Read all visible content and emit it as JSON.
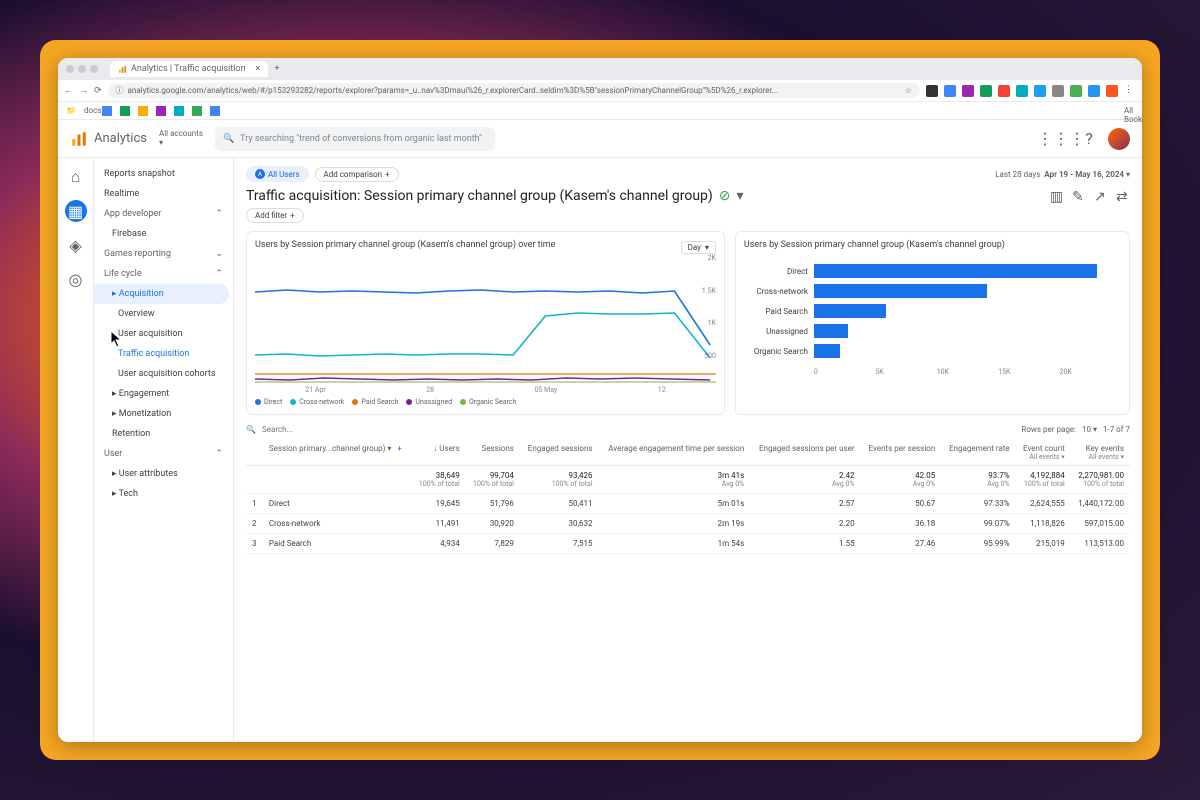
{
  "browser": {
    "tab_title": "Analytics | Traffic acquisition",
    "url": "analytics.google.com/analytics/web/#/p153293282/reports/explorer?params=_u..nav%3Dmaui%26_r.explorerCard..seldim%3D%5B\"sessionPrimaryChannelGroup\"%5D%26_r.explorer...",
    "bookmark_folder": "docs",
    "all_bookmarks": "All Bookmarks"
  },
  "header": {
    "product": "Analytics",
    "account_label": "All accounts",
    "search_placeholder": "Try searching \"trend of conversions from organic last month\""
  },
  "nav": {
    "snapshot": "Reports snapshot",
    "realtime": "Realtime",
    "app_dev": "App developer",
    "firebase": "Firebase",
    "games": "Games reporting",
    "lifecycle": "Life cycle",
    "acquisition": "Acquisition",
    "overview": "Overview",
    "user_acq": "User acquisition",
    "traffic_acq": "Traffic acquisition",
    "user_cohorts": "User acquisition cohorts",
    "engagement": "Engagement",
    "monetization": "Monetization",
    "retention": "Retention",
    "user": "User",
    "user_attr": "User attributes",
    "tech": "Tech"
  },
  "page": {
    "all_users": "All Users",
    "add_comparison": "Add comparison",
    "date_label": "Last 28 days",
    "date_range": "Apr 19 - May 16, 2024",
    "title": "Traffic acquisition: Session primary channel group (Kasem's channel group)",
    "add_filter": "Add filter"
  },
  "chart_data": [
    {
      "type": "line",
      "title": "Users by Session primary channel group (Kasem's channel group) over time",
      "interval": "Day",
      "x": [
        "21 Apr",
        "28",
        "05 May",
        "12"
      ],
      "ylim": [
        0,
        2000
      ],
      "yticks": [
        "2K",
        "1.5K",
        "1K",
        "500"
      ],
      "series": [
        {
          "name": "Direct",
          "color": "#1a73e8",
          "values": [
            1400,
            1450,
            1400,
            1420,
            1400,
            1380,
            1410,
            1430,
            1400,
            1420,
            1400,
            1410,
            1380,
            1420,
            600
          ]
        },
        {
          "name": "Cross-network",
          "color": "#12b5cb",
          "values": [
            450,
            460,
            440,
            450,
            460,
            450,
            455,
            460,
            450,
            1050,
            1100,
            1080,
            1070,
            1090,
            400
          ]
        },
        {
          "name": "Paid Search",
          "color": "#e8710a",
          "values": [
            150,
            160,
            150,
            155,
            150,
            160,
            155,
            150,
            155,
            160,
            150,
            155,
            160,
            150,
            120
          ]
        },
        {
          "name": "Unassigned",
          "color": "#7b1fa2",
          "values": [
            70,
            60,
            80,
            70,
            60,
            70,
            65,
            70,
            60,
            75,
            70,
            80,
            70,
            60,
            50
          ]
        },
        {
          "name": "Organic Search",
          "color": "#7cb342",
          "values": [
            40,
            45,
            40,
            42,
            40,
            41,
            43,
            40,
            42,
            40,
            41,
            40,
            42,
            40,
            35
          ]
        }
      ]
    },
    {
      "type": "bar",
      "title": "Users by Session primary channel group (Kasem's channel group)",
      "categories": [
        "Direct",
        "Cross-network",
        "Paid Search",
        "Unassigned",
        "Organic Search"
      ],
      "values": [
        19645,
        12000,
        4934,
        2200,
        1800
      ],
      "xlim": [
        0,
        20000
      ],
      "xticks": [
        "0",
        "5K",
        "10K",
        "15K",
        "20K"
      ]
    }
  ],
  "table": {
    "search_placeholder": "Search...",
    "rows_label": "Rows per page:",
    "rows_value": "10",
    "page_info": "1-7 of 7",
    "dim_header": "Session primary...channel group)",
    "cols": [
      {
        "h": "↓ Users"
      },
      {
        "h": "Sessions"
      },
      {
        "h": "Engaged sessions"
      },
      {
        "h": "Average engagement time per session"
      },
      {
        "h": "Engaged sessions per user"
      },
      {
        "h": "Events per session"
      },
      {
        "h": "Engagement rate"
      },
      {
        "h": "Event count",
        "sub": "All events ▾"
      },
      {
        "h": "Key events",
        "sub": "All events ▾"
      }
    ],
    "totals": {
      "users": {
        "v": "38,649",
        "s": "100% of total"
      },
      "sessions": {
        "v": "99,704",
        "s": "100% of total"
      },
      "engaged": {
        "v": "93,426",
        "s": "100% of total"
      },
      "avgeng": {
        "v": "3m 41s",
        "s": "Avg 0%"
      },
      "espu": {
        "v": "2.42",
        "s": "Avg 0%"
      },
      "eps": {
        "v": "42.05",
        "s": "Avg 0%"
      },
      "er": {
        "v": "93.7%",
        "s": "Avg 0%"
      },
      "ec": {
        "v": "4,192,884",
        "s": "100% of total"
      },
      "ke": {
        "v": "2,270,981.00",
        "s": "100% of total"
      }
    },
    "rows": [
      {
        "n": "1",
        "dim": "Direct",
        "v": [
          "19,645",
          "51,796",
          "50,411",
          "5m 01s",
          "2.57",
          "50.67",
          "97.33%",
          "2,624,555",
          "1,440,172.00"
        ]
      },
      {
        "n": "2",
        "dim": "Cross-network",
        "v": [
          "11,491",
          "30,920",
          "30,632",
          "2m 19s",
          "2.20",
          "36.18",
          "99.07%",
          "1,118,826",
          "597,015.00"
        ]
      },
      {
        "n": "3",
        "dim": "Paid Search",
        "v": [
          "4,934",
          "7,829",
          "7,515",
          "1m 54s",
          "1.55",
          "27.46",
          "95.99%",
          "215,019",
          "113,513.00"
        ]
      }
    ]
  }
}
